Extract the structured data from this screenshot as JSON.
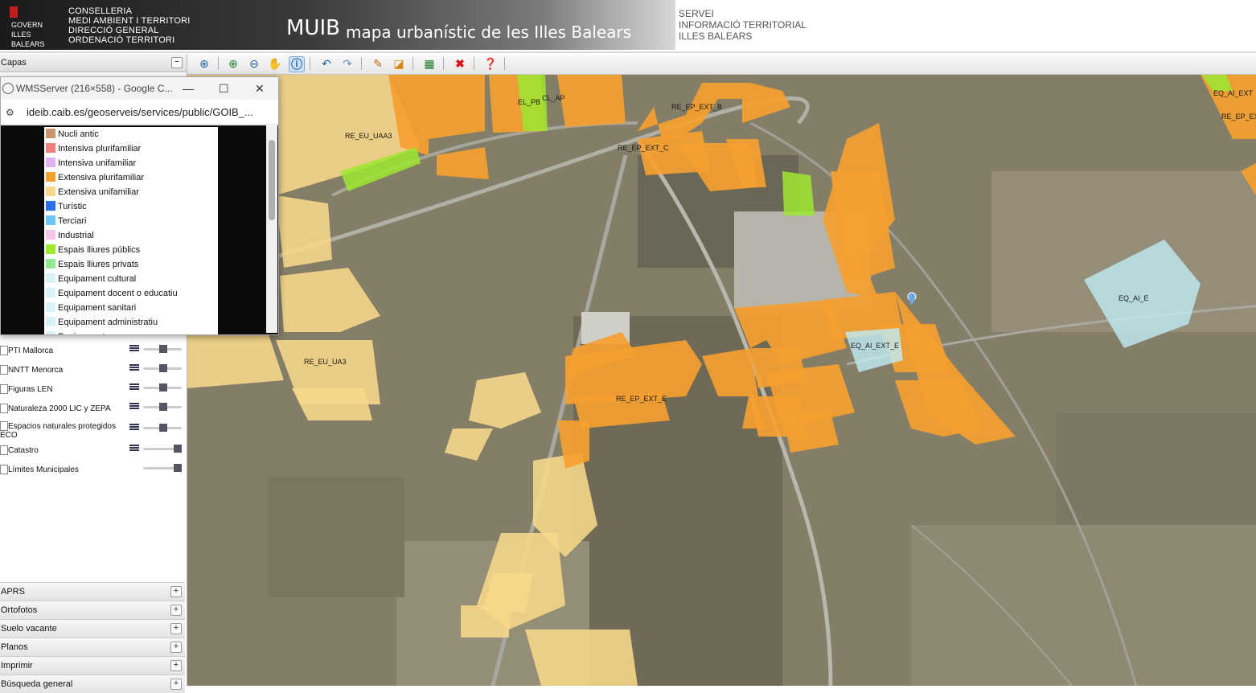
{
  "header": {
    "logo_lines": [
      "GOVERN",
      "ILLES",
      "BALEARS"
    ],
    "conselleria_lines": [
      "CONSELLERIA",
      "MEDI AMBIENT I TERRITORI",
      "DIRECCIÓ GENERAL",
      "ORDENACIÓ TERRITORI"
    ],
    "app_title": "MUIB",
    "app_subtitle": "mapa urbanístic de les Illes Balears",
    "servei_lines": [
      "SERVEI",
      "INFORMACIÓ TERRITORIAL",
      "ILLES BALEARS"
    ]
  },
  "left_panel": {
    "capas_title": "Capas",
    "layers": [
      {
        "name": "PTI Mallorca"
      },
      {
        "name": "NNTT Menorca"
      },
      {
        "name": "Figuras LEN"
      },
      {
        "name": "Naturaleza 2000 LIC y ZEPA"
      },
      {
        "name": "Espacios naturales protegidos ECO"
      },
      {
        "name": "Catastro"
      },
      {
        "name": "Límites Municipales"
      }
    ],
    "accordions": [
      "APRS",
      "Ortofotos",
      "Suelo vacante",
      "Planos",
      "Imprimir",
      "Búsqueda general"
    ]
  },
  "toolbar": {
    "icons": [
      "zoom-extent-icon",
      "zoom-in-icon",
      "zoom-out-icon",
      "pan-hand-icon",
      "info-icon",
      "undo-icon",
      "redo-icon",
      "measure-line-icon",
      "measure-area-icon",
      "legend-icon",
      "clear-icon",
      "help-icon"
    ]
  },
  "popup": {
    "title": "WMSServer (216×558) - Google C...",
    "url": "ideib.caib.es/geoserveis/services/public/GOIB_...",
    "legend": [
      {
        "label": "Nucli antic",
        "color": "#c8966e"
      },
      {
        "label": "Intensiva plurifamiliar",
        "color": "#f08080"
      },
      {
        "label": "Intensiva unifamiliar",
        "color": "#e0b0f0"
      },
      {
        "label": "Extensiva plurifamiliar",
        "color": "#f5a030"
      },
      {
        "label": "Extensiva unifamiliar",
        "color": "#f8d88a"
      },
      {
        "label": "Turístic",
        "color": "#2a6fe8"
      },
      {
        "label": "Terciari",
        "color": "#6cc4f5"
      },
      {
        "label": "Industrial",
        "color": "#f5c4e8"
      },
      {
        "label": "Espais lliures públics",
        "color": "#9ee830"
      },
      {
        "label": "Espais lliures privats",
        "color": "#90e890"
      },
      {
        "label": "Equipament cultural",
        "color": "#d8f4f8"
      },
      {
        "label": "Equipament docent o educatiu",
        "color": "#d8f4f8"
      },
      {
        "label": "Equipament sanitari",
        "color": "#d8f4f8"
      },
      {
        "label": "Equipament administratiu",
        "color": "#d8f4f8"
      },
      {
        "label": "Equipament ...",
        "color": "#d8f4f8"
      }
    ]
  },
  "map": {
    "labels": [
      "RE_EU_UAA3",
      "EL_PB",
      "CL_AP",
      "RE_EP_EXT_B",
      "RE_EP_EXT_C",
      "EQ_AI_EXT_E",
      "EQ_AI_E",
      "RE_EU_UA3",
      "RE_EP_EXT_E",
      "EQ_AI_EXT",
      "RE_EP_EX"
    ],
    "colors": {
      "extensiva_plurifamiliar": "#f5a030",
      "extensiva_unifamiliar": "#f8d88a",
      "espais_lliures": "#9ee830",
      "equipament": "#bfeaf2"
    }
  }
}
